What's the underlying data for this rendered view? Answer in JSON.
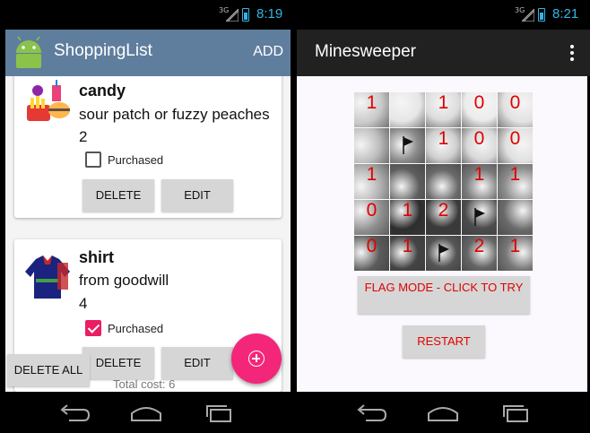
{
  "left_phone": {
    "status": {
      "network": "3G",
      "time": "8:19"
    },
    "app_title": "ShoppingList",
    "add_label": "ADD",
    "items": [
      {
        "name": "candy",
        "description": "sour patch or fuzzy peaches",
        "quantity": "2",
        "purchased_label": "Purchased",
        "purchased": false,
        "delete_label": "DELETE",
        "edit_label": "EDIT"
      },
      {
        "name": "shirt",
        "description": "from goodwill",
        "quantity": "4",
        "purchased_label": "Purchased",
        "purchased": true,
        "delete_label": "DELETE",
        "edit_label": "EDIT"
      }
    ],
    "delete_all_label": "DELETE ALL",
    "total_cost": "Total cost: 6",
    "fab_icon": "add-circle-icon",
    "colors": {
      "actionbar": "#5f7e9d",
      "fab": "#f3267a",
      "checkbox_checked": "#e91e63"
    }
  },
  "right_phone": {
    "status": {
      "network": "3G",
      "time": "8:21"
    },
    "app_title": "Minesweeper",
    "overflow_icon": "overflow-menu-icon",
    "board": [
      [
        "1",
        "",
        "1",
        "0",
        "0"
      ],
      [
        "",
        "flag",
        "1",
        "0",
        "0"
      ],
      [
        "1",
        "",
        "",
        "1",
        "1"
      ],
      [
        "0",
        "1",
        "2",
        "flag",
        ""
      ],
      [
        "0",
        "1",
        "flag",
        "2",
        "1"
      ]
    ],
    "flag_mode_label": "FLAG MODE - CLICK TO TRY",
    "restart_label": "RESTART",
    "colors": {
      "actionbar": "#212121",
      "number": "#e00000"
    }
  }
}
